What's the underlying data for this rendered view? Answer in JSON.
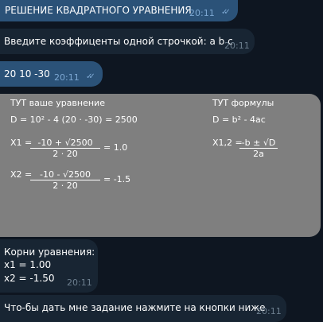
{
  "messages": [
    {
      "text": "РЕШЕНИЕ КВАДРАТНОГО УРАВНЕНИЯ",
      "time": "20:11",
      "direction": "outgoing",
      "status": "read"
    },
    {
      "text": "Введите коэффиценты одной строчкой: a b c",
      "time": "20:11",
      "direction": "incoming"
    },
    {
      "text": "20 10 -30",
      "time": "20:11",
      "direction": "outgoing",
      "status": "read"
    }
  ],
  "image": {
    "left_title": "ТУТ ваше уравнение",
    "discriminant": "D = 10² - 4 (20 · -30) = 2500",
    "x1_label": "X1 =",
    "x1_num": "-10 + √2500",
    "x1_den": "2 · 20",
    "x1_result": "= 1.0",
    "x2_label": "X2 =",
    "x2_num": "-10 - √2500",
    "x2_den": "2 · 20",
    "x2_result": "= -1.5",
    "right_title": "ТУТ формулы",
    "formula_d": "D = b² - 4ac",
    "formula_x_label": "X1,2 =",
    "formula_x_num": "-b ± √D",
    "formula_x_den": "2a"
  },
  "roots": {
    "line1": "Корни уравнения:",
    "line2": "x1 = 1.00",
    "line3": "x2 = -1.50",
    "time": "20:11"
  },
  "last": {
    "text": "Что-бы дать мне задание нажмите на кнопки ниже",
    "time": "20:11"
  },
  "colors": {
    "background": "#0e1621",
    "outgoing": "#2b5278",
    "incoming": "#182533",
    "image": "#7f7f7f"
  }
}
